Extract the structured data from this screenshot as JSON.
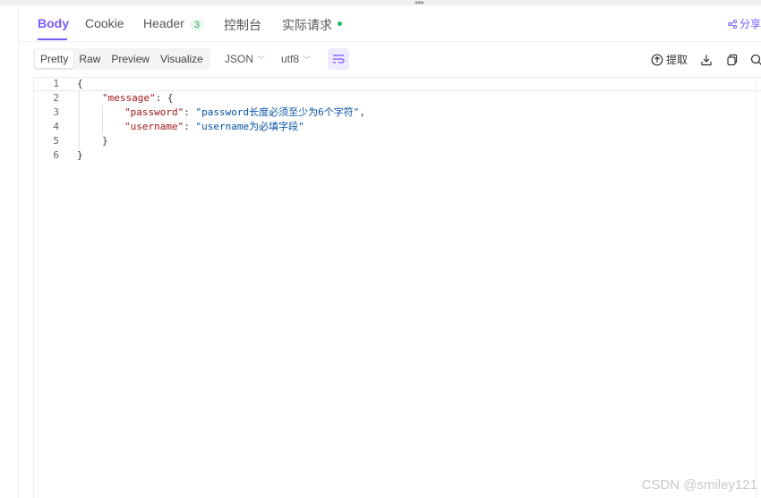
{
  "tabs": [
    {
      "label": "Body"
    },
    {
      "label": "Cookie"
    },
    {
      "label": "Header",
      "badge": "3"
    },
    {
      "label": "控制台"
    },
    {
      "label": "实际请求"
    }
  ],
  "share_label": "分享",
  "view_modes": [
    "Pretty",
    "Raw",
    "Preview",
    "Visualize"
  ],
  "format": {
    "selected": "JSON"
  },
  "encoding": {
    "selected": "utf8"
  },
  "toolbar": {
    "extract_label": "提取"
  },
  "editor": {
    "line_numbers": [
      "1",
      "2",
      "3",
      "4",
      "5",
      "6"
    ],
    "lines": {
      "l1": {
        "brace": "{"
      },
      "l2": {
        "key": "\"message\"",
        "colon": ": ",
        "brace": "{"
      },
      "l3": {
        "key": "\"password\"",
        "colon": ": ",
        "value": "\"password长度必须至少为6个字符\"",
        "comma": ","
      },
      "l4": {
        "key": "\"username\"",
        "colon": ": ",
        "value": "\"username为必填字段\""
      },
      "l5": {
        "brace": "}"
      },
      "l6": {
        "brace": "}"
      }
    }
  },
  "watermark": "CSDN @smiley121",
  "colors": {
    "accent": "#7a5af8",
    "dot": "#22b96b",
    "json_key": "#a31515",
    "json_string": "#0451a5"
  }
}
